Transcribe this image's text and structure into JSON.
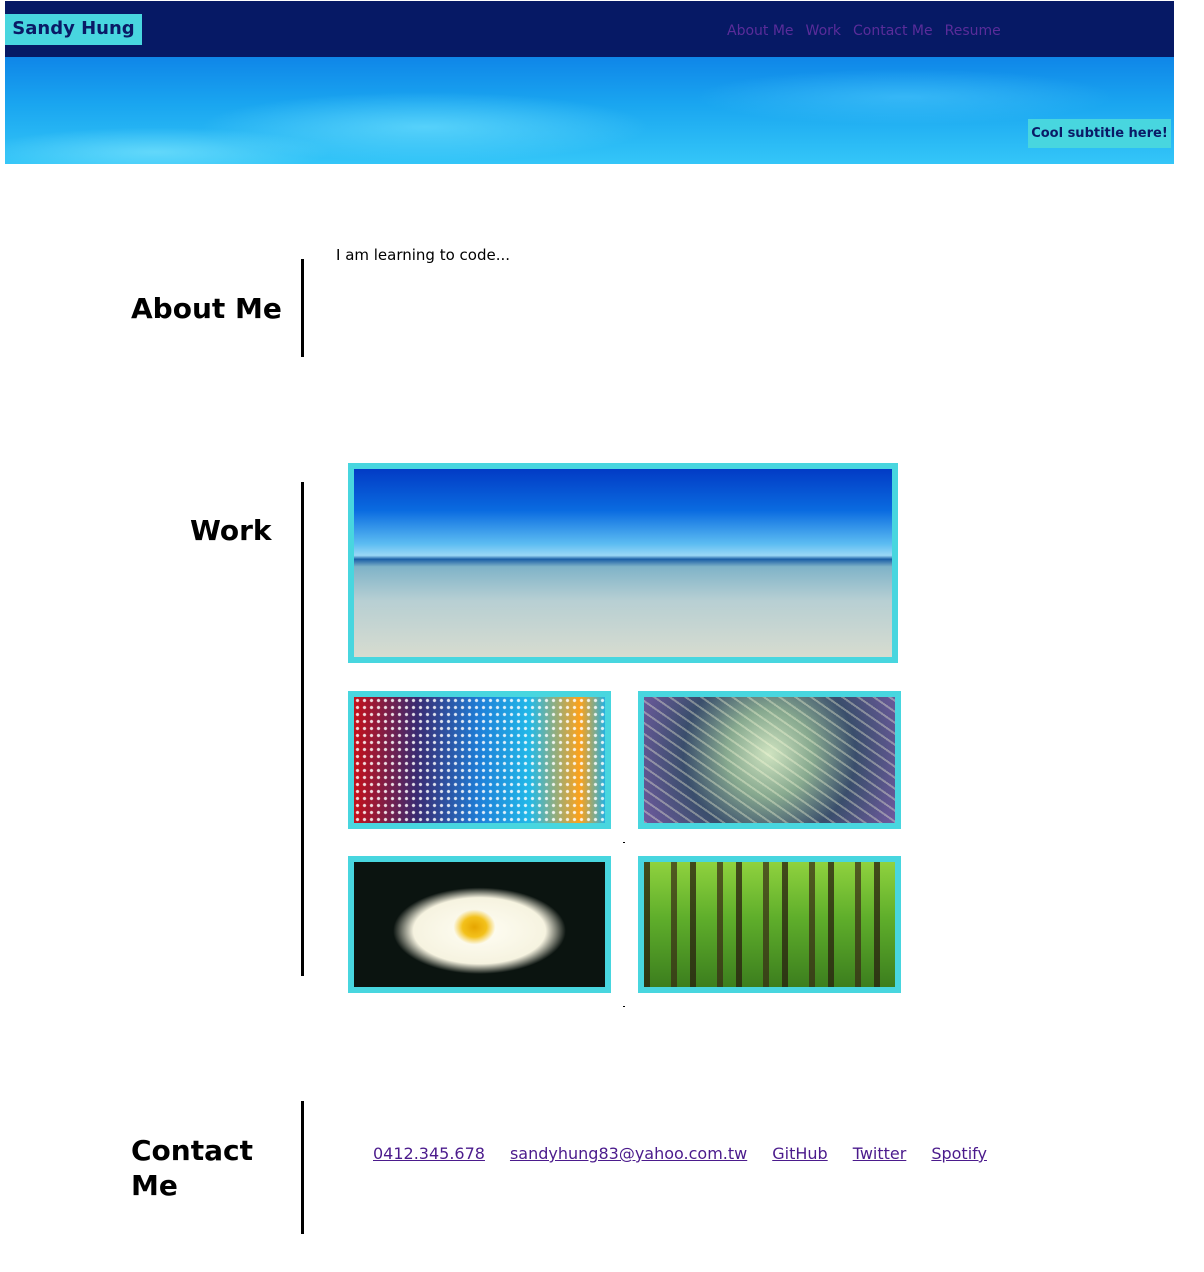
{
  "header": {
    "brand": "Sandy Hung",
    "nav": [
      "About Me",
      "Work",
      "Contact Me",
      "Resume"
    ]
  },
  "hero": {
    "subtitle": "Cool subtitle here!"
  },
  "about": {
    "title": "About Me",
    "text": "I am learning to code..."
  },
  "work": {
    "title": "Work",
    "images": [
      "ocean-horizon",
      "led-lights",
      "circuit-board",
      "plumeria-flower",
      "green-forest"
    ]
  },
  "contact": {
    "title_line1": "Contact",
    "title_line2": "Me",
    "links": [
      "0412.345.678",
      "sandyhung83@yahoo.com.tw",
      "GitHub",
      "Twitter",
      "Spotify"
    ]
  },
  "colors": {
    "navbar": "#061965",
    "accent": "#48d6df",
    "link": "#4b1b8c"
  }
}
